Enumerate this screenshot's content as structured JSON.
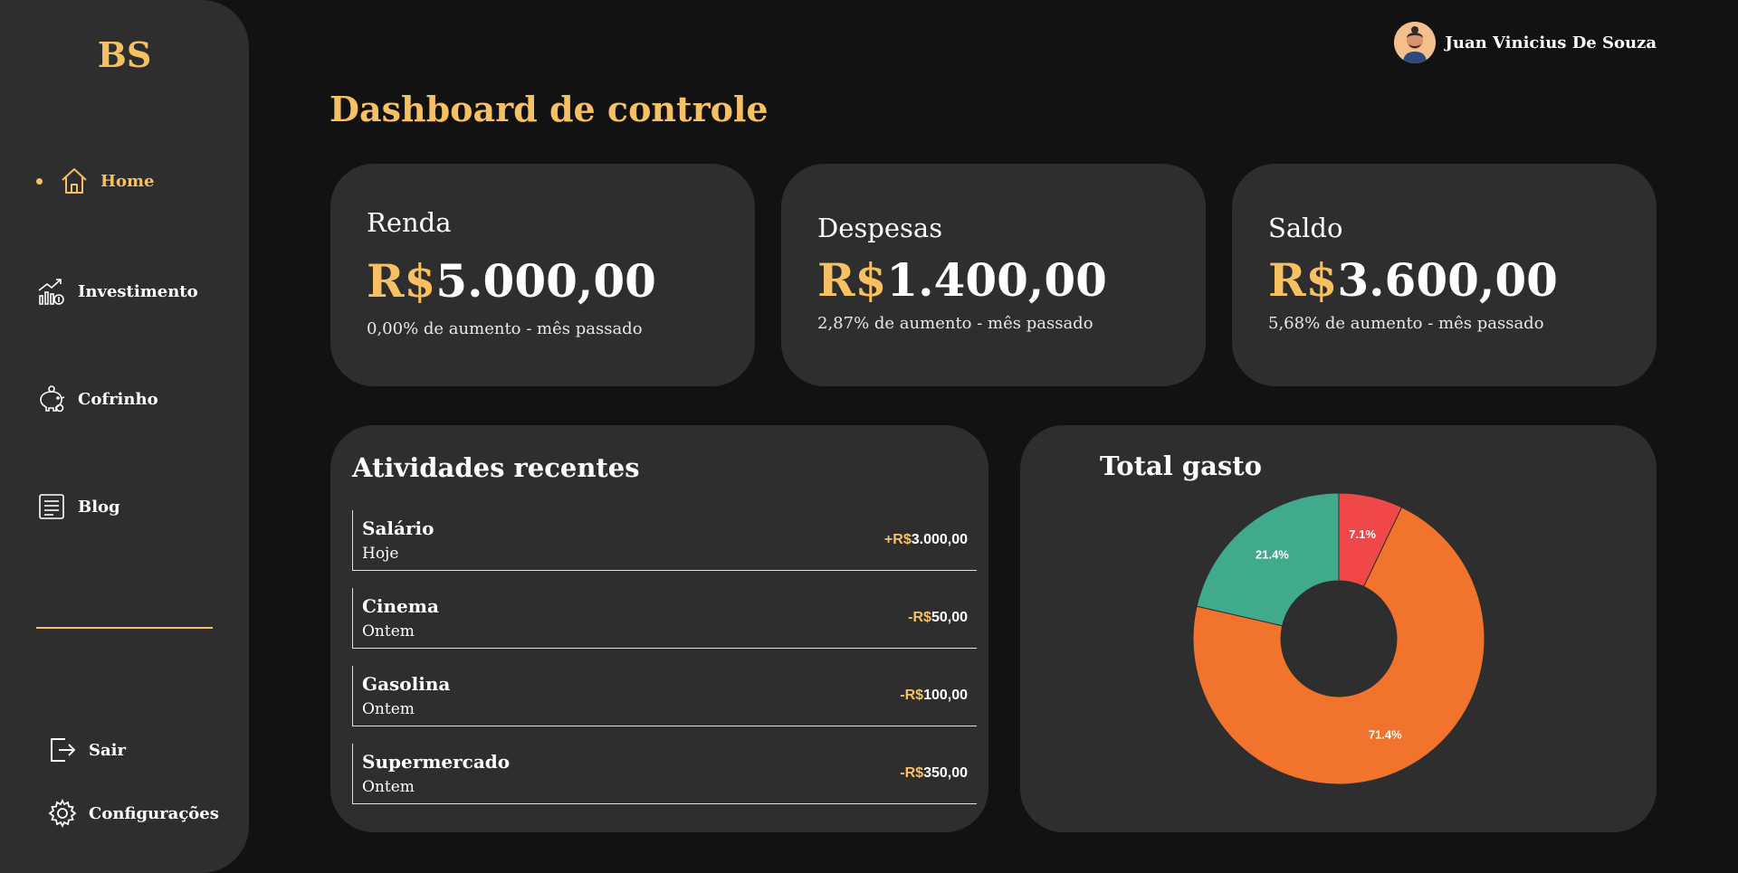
{
  "sidebar": {
    "logo": "BS",
    "items": [
      {
        "label": "Home",
        "icon": "home-icon"
      },
      {
        "label": "Investimento",
        "icon": "investment-chart-icon"
      },
      {
        "label": "Cofrinho",
        "icon": "piggy-bank-icon"
      },
      {
        "label": "Blog",
        "icon": "document-icon"
      }
    ],
    "bottom": [
      {
        "label": "Sair",
        "icon": "logout-icon"
      },
      {
        "label": "Configurações",
        "icon": "gear-icon"
      }
    ]
  },
  "user": {
    "name": "Juan Vinicius De Souza"
  },
  "page": {
    "title": "Dashboard de controle"
  },
  "stats": [
    {
      "label": "Renda",
      "currency": "R$",
      "amount": "5.000,00",
      "sub": "0,00% de aumento - mês passado"
    },
    {
      "label": "Despesas",
      "currency": "R$",
      "amount": "1.400,00",
      "sub": "2,87% de aumento - mês passado"
    },
    {
      "label": "Saldo",
      "currency": "R$",
      "amount": "3.600,00",
      "sub": "5,68% de aumento - mês passado"
    }
  ],
  "activity": {
    "title": "Atividades recentes",
    "rows": [
      {
        "name": "Salário",
        "date": "Hoje",
        "sign": "+R$",
        "amount": "3.000,00"
      },
      {
        "name": "Cinema",
        "date": "Ontem",
        "sign": "-R$",
        "amount": "50,00"
      },
      {
        "name": "Gasolina",
        "date": "Ontem",
        "sign": "-R$",
        "amount": "100,00"
      },
      {
        "name": "Supermercado",
        "date": "Ontem",
        "sign": "-R$",
        "amount": "350,00"
      }
    ]
  },
  "chart_data": {
    "type": "pie",
    "title": "Total gasto",
    "donut": true,
    "slices": [
      {
        "value": 7.1,
        "label": "7.1%",
        "color": "#f04848"
      },
      {
        "value": 71.4,
        "label": "71.4%",
        "color": "#f2742c"
      },
      {
        "value": 21.4,
        "label": "21.4%",
        "color": "#41a98c"
      }
    ]
  },
  "colors": {
    "accent": "#f6c063",
    "card": "#2e2e2e",
    "background": "#121212"
  }
}
